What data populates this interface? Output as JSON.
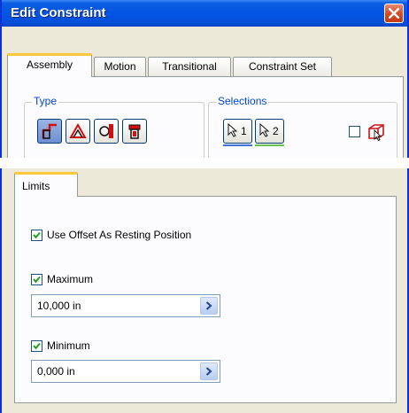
{
  "dialog": {
    "title": "Edit Constraint",
    "tabs": [
      {
        "label": "Assembly",
        "active": true
      },
      {
        "label": "Motion",
        "active": false
      },
      {
        "label": "Transitional",
        "active": false
      },
      {
        "label": "Constraint Set",
        "active": false
      }
    ],
    "type_group": {
      "label": "Type",
      "buttons": [
        {
          "icon": "mate-constraint-icon",
          "pressed": true
        },
        {
          "icon": "angle-constraint-icon",
          "pressed": false
        },
        {
          "icon": "tangent-constraint-icon",
          "pressed": false
        },
        {
          "icon": "insert-constraint-icon",
          "pressed": false
        }
      ]
    },
    "selections_group": {
      "label": "Selections",
      "buttons": [
        {
          "label": "1",
          "icon": "select-arrow-icon",
          "underline_color": "#3f72d8"
        },
        {
          "label": "2",
          "icon": "select-arrow-icon",
          "underline_color": "#6cc04a"
        }
      ],
      "pick_part_first": {
        "checked": false,
        "icon": "pick-part-first-icon"
      }
    }
  },
  "limits": {
    "tab_label": "Limits",
    "use_offset": {
      "label": "Use Offset As Resting Position",
      "checked": true
    },
    "maximum": {
      "label": "Maximum",
      "checked": true,
      "value": "10,000 in"
    },
    "minimum": {
      "label": "Minimum",
      "checked": true,
      "value": "0,000 in"
    }
  },
  "colors": {
    "titlebar": "#0554e3",
    "dialog_bg": "#ece9d8",
    "check_green": "#21a121",
    "group_label": "#0046d5"
  }
}
